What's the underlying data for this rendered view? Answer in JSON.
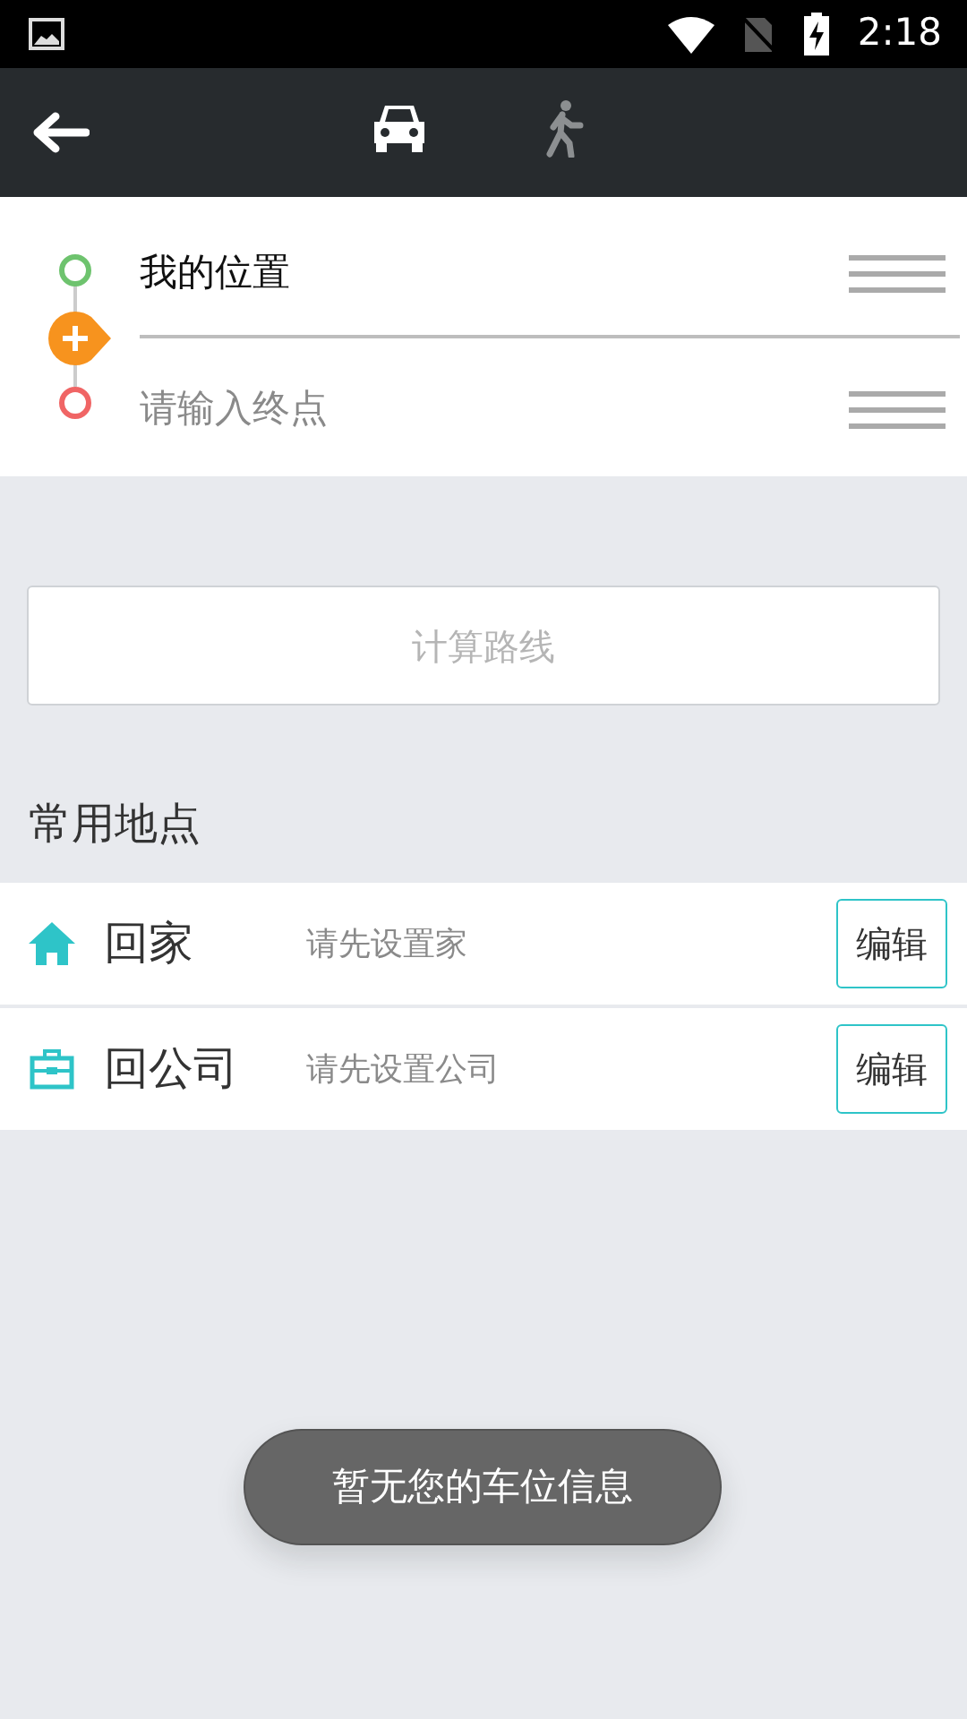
{
  "status_bar": {
    "time": "2:18"
  },
  "header": {
    "modes": [
      {
        "kind": "car",
        "selected": true
      },
      {
        "kind": "walk",
        "selected": false
      }
    ]
  },
  "route": {
    "start": {
      "value": "我的位置"
    },
    "end": {
      "placeholder": "请输入终点"
    }
  },
  "calculate_button": "计算路线",
  "favorites": {
    "title": "常用地点",
    "items": [
      {
        "kind": "home",
        "label": "回家",
        "hint": "请先设置家",
        "edit": "编辑"
      },
      {
        "kind": "work",
        "label": "回公司",
        "hint": "请先设置公司",
        "edit": "编辑"
      }
    ]
  },
  "toast": "暂无您的车位信息"
}
